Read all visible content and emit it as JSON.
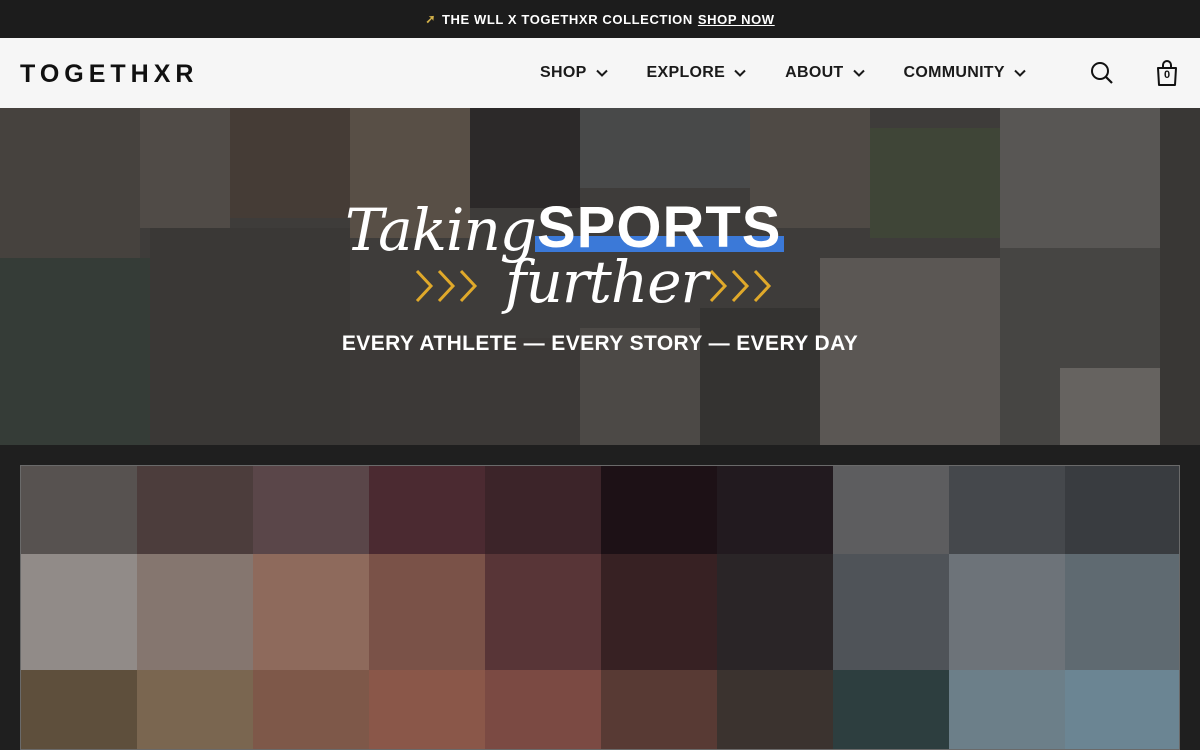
{
  "announcement": {
    "text": "THE WLL X TOGETHXR COLLECTION",
    "link": "SHOP NOW"
  },
  "header": {
    "logo": "TOGETHXR",
    "nav": [
      {
        "label": "SHOP"
      },
      {
        "label": "EXPLORE"
      },
      {
        "label": "ABOUT"
      },
      {
        "label": "COMMUNITY"
      }
    ],
    "cart_count": "0"
  },
  "hero": {
    "title_part1": "Taking",
    "title_highlight": "SPORTS",
    "title_part2": "further",
    "subtitle": "EVERY ATHLETE — EVERY STORY — EVERY DAY",
    "highlight_color": "#3b79d8",
    "chevron_color": "#e0a92a"
  },
  "pixel_grid": {
    "colors": [
      [
        "#575250",
        "#4c3d3c",
        "#5a4649",
        "#4b2a31",
        "#3c2429",
        "#1d1116",
        "#221a1f",
        "#5d5d5f",
        "#45484c",
        "#393c40"
      ],
      [
        "#918b88",
        "#85766f",
        "#8e6a5c",
        "#7a5248",
        "#583537",
        "#372123",
        "#2a2527",
        "#4f5358",
        "#6d7379",
        "#5f6a71"
      ],
      [
        "#5e4f3c",
        "#7a6650",
        "#7e5849",
        "#8a5749",
        "#7b4a43",
        "#583a34",
        "#3b332f",
        "#2d3e3f",
        "#6c7f89",
        "#6b8593"
      ]
    ]
  }
}
